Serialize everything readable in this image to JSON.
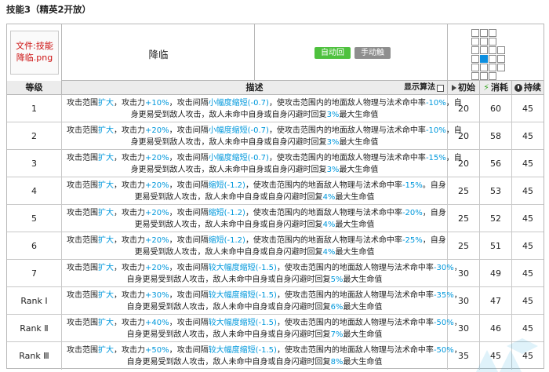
{
  "page_title": "技能3（精英2开放）",
  "skill": {
    "image_alt": "文件:技能 降临.png",
    "name": "降临",
    "tags": [
      "自动回复",
      "手动触发"
    ]
  },
  "columns": {
    "level": "等级",
    "description": "描述",
    "show_formula": "显示算法",
    "sp_initial": "初始",
    "sp_cost": "消耗",
    "duration": "持续"
  },
  "rows": [
    {
      "level": "1",
      "l1": [
        [
          "攻击范围",
          ""
        ],
        [
          "扩大",
          "hl"
        ],
        [
          "，攻击力",
          ""
        ],
        [
          "+10%",
          "hl"
        ],
        [
          "，攻击间隔",
          ""
        ],
        [
          "小幅度缩短",
          "hl"
        ],
        [
          "(-0.7)",
          "hl"
        ],
        [
          "，使攻击范围内的地面敌人物理与法术命中率",
          ""
        ],
        [
          "-10%",
          "hl"
        ],
        [
          "，自",
          ""
        ]
      ],
      "l2": [
        [
          "身更易受到敌人攻击，敌人未命中自身或自身闪避时回复",
          ""
        ],
        [
          "3%",
          "hl"
        ],
        [
          "最大生命值",
          ""
        ]
      ],
      "init": "20",
      "cost": "60",
      "dur": "45"
    },
    {
      "level": "2",
      "l1": [
        [
          "攻击范围",
          ""
        ],
        [
          "扩大",
          "hl"
        ],
        [
          "，攻击力",
          ""
        ],
        [
          "+20%",
          "hl"
        ],
        [
          "，攻击间隔",
          ""
        ],
        [
          "小幅度缩短",
          "hl"
        ],
        [
          "(-0.7)",
          "hl"
        ],
        [
          "，使攻击范围内的地面敌人物理与法术命中率",
          ""
        ],
        [
          "-10%",
          "hl"
        ],
        [
          "，自",
          ""
        ]
      ],
      "l2": [
        [
          "身更易受到敌人攻击，敌人未命中自身或自身闪避时回复",
          ""
        ],
        [
          "3%",
          "hl"
        ],
        [
          "最大生命值",
          ""
        ]
      ],
      "init": "20",
      "cost": "58",
      "dur": "45"
    },
    {
      "level": "3",
      "l1": [
        [
          "攻击范围",
          ""
        ],
        [
          "扩大",
          "hl"
        ],
        [
          "，攻击力",
          ""
        ],
        [
          "+20%",
          "hl"
        ],
        [
          "，攻击间隔",
          ""
        ],
        [
          "小幅度缩短",
          "hl"
        ],
        [
          "(-0.7)",
          "hl"
        ],
        [
          "，使攻击范围内的地面敌人物理与法术命中率",
          ""
        ],
        [
          "-15%",
          "hl"
        ],
        [
          "，自",
          ""
        ]
      ],
      "l2": [
        [
          "身更易受到敌人攻击，敌人未命中自身或自身闪避时回复",
          ""
        ],
        [
          "3%",
          "hl"
        ],
        [
          "最大生命值",
          ""
        ]
      ],
      "init": "20",
      "cost": "56",
      "dur": "45"
    },
    {
      "level": "4",
      "l1": [
        [
          "攻击范围",
          ""
        ],
        [
          "扩大",
          "hl"
        ],
        [
          "，攻击力",
          ""
        ],
        [
          "+20%",
          "hl"
        ],
        [
          "，攻击间隔",
          ""
        ],
        [
          "缩短",
          "hl"
        ],
        [
          "(-1.2)",
          "hl"
        ],
        [
          "，使攻击范围内的地面敌人物理与法术命中率",
          ""
        ],
        [
          "-15%",
          "hl"
        ],
        [
          "。自身",
          ""
        ]
      ],
      "l2": [
        [
          "更易受到敌人攻击，敌人未命中自身或自身闪避时回复",
          ""
        ],
        [
          "4%",
          "hl"
        ],
        [
          "最大生命值",
          ""
        ]
      ],
      "init": "25",
      "cost": "53",
      "dur": "45"
    },
    {
      "level": "5",
      "l1": [
        [
          "攻击范围",
          ""
        ],
        [
          "扩大",
          "hl"
        ],
        [
          "，攻击力",
          ""
        ],
        [
          "+20%",
          "hl"
        ],
        [
          "，攻击间隔",
          ""
        ],
        [
          "缩短",
          "hl"
        ],
        [
          "(-1.2)",
          "hl"
        ],
        [
          "，使攻击范围内的地面敌人物理与法术命中率",
          ""
        ],
        [
          "-20%",
          "hl"
        ],
        [
          "，自身",
          ""
        ]
      ],
      "l2": [
        [
          "更易受到敌人攻击，敌人未命中自身或自身闪避时回复",
          ""
        ],
        [
          "4%",
          "hl"
        ],
        [
          "最大生命值",
          ""
        ]
      ],
      "init": "25",
      "cost": "52",
      "dur": "45"
    },
    {
      "level": "6",
      "l1": [
        [
          "攻击范围",
          ""
        ],
        [
          "扩大",
          "hl"
        ],
        [
          "，攻击力",
          ""
        ],
        [
          "+20%",
          "hl"
        ],
        [
          "，攻击间隔",
          ""
        ],
        [
          "缩短",
          "hl"
        ],
        [
          "(-1.2)",
          "hl"
        ],
        [
          "，使攻击范围内的地面敌人物理与法术命中率",
          ""
        ],
        [
          "-25%",
          "hl"
        ],
        [
          "，自身",
          ""
        ]
      ],
      "l2": [
        [
          "更易受到敌人攻击，敌人未命中自身或自身闪避时回复",
          ""
        ],
        [
          "4%",
          "hl"
        ],
        [
          "最大生命值",
          ""
        ]
      ],
      "init": "25",
      "cost": "51",
      "dur": "45"
    },
    {
      "level": "7",
      "l1": [
        [
          "攻击范围",
          ""
        ],
        [
          "扩大",
          "hl"
        ],
        [
          "，攻击力",
          ""
        ],
        [
          "+20%",
          "hl"
        ],
        [
          "，攻击间隔",
          ""
        ],
        [
          "较大幅度缩短",
          "hl"
        ],
        [
          "(-1.5)",
          "hl"
        ],
        [
          "，使攻击范围内的地面敌人物理与法术命中率",
          ""
        ],
        [
          "-30%",
          "hl"
        ],
        [
          "，",
          ""
        ]
      ],
      "l2": [
        [
          "自身更易受到敌人攻击，敌人未命中自身或自身闪避时回复",
          ""
        ],
        [
          "5%",
          "hl"
        ],
        [
          "最大生命值",
          ""
        ]
      ],
      "init": "30",
      "cost": "49",
      "dur": "45"
    },
    {
      "level": "Rank Ⅰ",
      "l1": [
        [
          "攻击范围",
          ""
        ],
        [
          "扩大",
          "hl"
        ],
        [
          "，攻击力",
          ""
        ],
        [
          "+30%",
          "hl"
        ],
        [
          "，攻击间隔",
          ""
        ],
        [
          "较大幅度缩短",
          "hl"
        ],
        [
          "(-1.5)",
          "hl"
        ],
        [
          "，使攻击范围内的地面敌人物理与法术命中率",
          ""
        ],
        [
          "-35%",
          "hl"
        ],
        [
          "，",
          ""
        ]
      ],
      "l2": [
        [
          "自身更易受到敌人攻击，敌人未命中自身或自身闪避时回复",
          ""
        ],
        [
          "6%",
          "hl"
        ],
        [
          "最大生命值",
          ""
        ]
      ],
      "init": "30",
      "cost": "47",
      "dur": "45"
    },
    {
      "level": "Rank Ⅱ",
      "l1": [
        [
          "攻击范围",
          ""
        ],
        [
          "扩大",
          "hl"
        ],
        [
          "，攻击力",
          ""
        ],
        [
          "+40%",
          "hl"
        ],
        [
          "，攻击间隔",
          ""
        ],
        [
          "较大幅度缩短",
          "hl"
        ],
        [
          "(-1.5)",
          "hl"
        ],
        [
          "，使攻击范围内的地面敌人物理与法术命中率",
          ""
        ],
        [
          "-50%",
          "hl"
        ],
        [
          "，",
          ""
        ]
      ],
      "l2": [
        [
          "自身更易受到敌人攻击，敌人未命中自身或自身闪避时回复",
          ""
        ],
        [
          "7%",
          "hl"
        ],
        [
          "最大生命值",
          ""
        ]
      ],
      "init": "30",
      "cost": "46",
      "dur": "45"
    },
    {
      "level": "Rank Ⅲ",
      "l1": [
        [
          "攻击范围",
          ""
        ],
        [
          "扩大",
          "hl"
        ],
        [
          "，攻击力",
          ""
        ],
        [
          "+50%",
          "hl"
        ],
        [
          "，攻击间隔",
          ""
        ],
        [
          "较大幅度缩短",
          "hl"
        ],
        [
          "(-1.5)",
          "hl"
        ],
        [
          "，使攻击范围内的地面敌人物理与法术命中率",
          ""
        ],
        [
          "-50%",
          "hl"
        ],
        [
          "，",
          ""
        ]
      ],
      "l2": [
        [
          "自身更易受到敌人攻击，敌人未命中自身或自身闪避时回复",
          ""
        ],
        [
          "8%",
          "hl"
        ],
        [
          "最大生命值",
          ""
        ]
      ],
      "init": "35",
      "cost": "45",
      "dur": "45"
    }
  ],
  "range_grid": [
    "nnn.",
    "nnn.",
    "nnnn",
    "nbnn",
    "nnnn",
    "nnn."
  ],
  "colors": {
    "highlight": "#0098dc",
    "tag_auto": "#4ec13e",
    "tag_manual": "#8e8e8e",
    "range_self": "#0d8fe0"
  }
}
